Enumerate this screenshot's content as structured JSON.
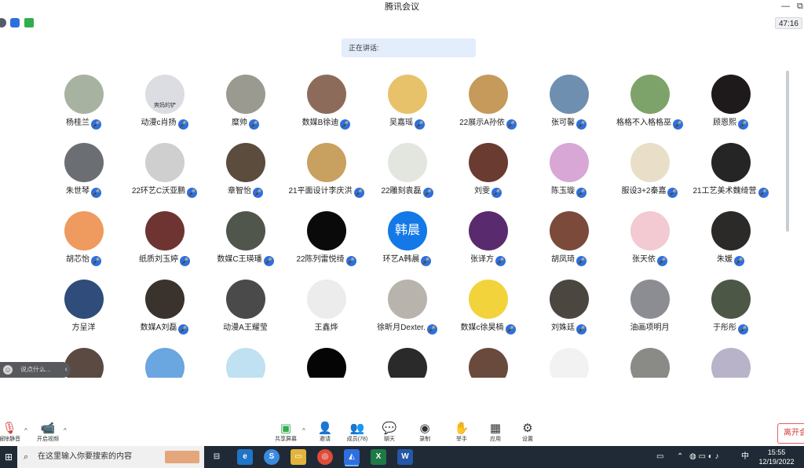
{
  "window": {
    "title": "腾讯会议",
    "minimize": "—",
    "restore": "⧉"
  },
  "topbar": {
    "timer": "47:16",
    "icons": [
      {
        "name": "network-status-icon",
        "color": "#555b66"
      },
      {
        "name": "security-shield-icon",
        "color": "#2d6fe0"
      },
      {
        "name": "signal-bars-icon",
        "color": "#2fae4e"
      }
    ]
  },
  "speaking": {
    "label": "正在讲话:"
  },
  "participants": [
    {
      "name": "杨桂兰",
      "mic": true,
      "avatar": {
        "bg": "#a7b3a0",
        "text": ""
      }
    },
    {
      "name": "动漫c肖扬",
      "mic": true,
      "avatar": {
        "bg": "#dcdde3",
        "text": "爽妈的铲"
      }
    },
    {
      "name": "糜帅",
      "mic": true,
      "avatar": {
        "bg": "#9a9a90",
        "text": ""
      }
    },
    {
      "name": "数媒B徐迪",
      "mic": true,
      "avatar": {
        "bg": "#8d6b5a",
        "text": ""
      }
    },
    {
      "name": "吴嘉瑶",
      "mic": true,
      "avatar": {
        "bg": "#e7c26a",
        "text": ""
      }
    },
    {
      "name": "22展示A孙依",
      "mic": true,
      "avatar": {
        "bg": "#c59a5a",
        "text": ""
      }
    },
    {
      "name": "张可馨",
      "mic": true,
      "avatar": {
        "bg": "#6f8fb0",
        "text": ""
      }
    },
    {
      "name": "格格不入格格巫",
      "mic": true,
      "avatar": {
        "bg": "#7ea36a",
        "text": ""
      }
    },
    {
      "name": "顾恩熙",
      "mic": true,
      "avatar": {
        "bg": "#1e1a1c",
        "text": ""
      }
    },
    {
      "name": "朱世琴",
      "mic": true,
      "avatar": {
        "bg": "#6b6f74",
        "text": ""
      }
    },
    {
      "name": "22环艺C沃亚鹏",
      "mic": true,
      "avatar": {
        "bg": "#cfcfcf",
        "text": ""
      }
    },
    {
      "name": "章智怡",
      "mic": true,
      "avatar": {
        "bg": "#5b4c3e",
        "text": ""
      }
    },
    {
      "name": "21平面设计李庆洪",
      "mic": true,
      "avatar": {
        "bg": "#c8a060",
        "text": ""
      }
    },
    {
      "name": "22雕刻袁磊",
      "mic": true,
      "avatar": {
        "bg": "#e3e6df",
        "text": ""
      }
    },
    {
      "name": "刘雯",
      "mic": true,
      "avatar": {
        "bg": "#6a3b30",
        "text": ""
      }
    },
    {
      "name": "陈玉璇",
      "mic": true,
      "avatar": {
        "bg": "#d8a7d6",
        "text": ""
      }
    },
    {
      "name": "服设3+2秦嘉",
      "mic": true,
      "avatar": {
        "bg": "#e9dfc9",
        "text": ""
      }
    },
    {
      "name": "21工艺美术魏绮营",
      "mic": true,
      "avatar": {
        "bg": "#252525",
        "text": ""
      }
    },
    {
      "name": "胡芯怡",
      "mic": true,
      "avatar": {
        "bg": "#ef9a5e",
        "text": ""
      }
    },
    {
      "name": "纸质刘玉婷",
      "mic": true,
      "avatar": {
        "bg": "#6e3432",
        "text": ""
      }
    },
    {
      "name": "数媒C王瑛璠",
      "mic": true,
      "avatar": {
        "bg": "#50564b",
        "text": ""
      }
    },
    {
      "name": "22陈列雷悦绮",
      "mic": true,
      "avatar": {
        "bg": "#0a0a0a",
        "text": ""
      }
    },
    {
      "name": "环艺A韩晨",
      "mic": true,
      "avatar": {
        "bg": "#1479e6",
        "text": "韩晨"
      }
    },
    {
      "name": "张译方",
      "mic": true,
      "avatar": {
        "bg": "#5a2a6e",
        "text": ""
      }
    },
    {
      "name": "胡凤琦",
      "mic": true,
      "avatar": {
        "bg": "#7b4a3a",
        "text": ""
      }
    },
    {
      "name": "张天依",
      "mic": true,
      "avatar": {
        "bg": "#f3c9d2",
        "text": ""
      }
    },
    {
      "name": "朱媛",
      "mic": true,
      "avatar": {
        "bg": "#2c2a28",
        "text": ""
      }
    },
    {
      "name": "方呈洋",
      "mic": false,
      "avatar": {
        "bg": "#2f4c7a",
        "text": ""
      }
    },
    {
      "name": "数媒A刘磊",
      "mic": true,
      "avatar": {
        "bg": "#3a322c",
        "text": ""
      }
    },
    {
      "name": "动漫A王耀莹",
      "mic": false,
      "avatar": {
        "bg": "#4a4a4a",
        "text": ""
      }
    },
    {
      "name": "王鑫烨",
      "mic": false,
      "avatar": {
        "bg": "#ececec",
        "text": ""
      }
    },
    {
      "name": "徐昕月Dexter.",
      "mic": true,
      "avatar": {
        "bg": "#b9b3ae",
        "text": ""
      }
    },
    {
      "name": "数媒c徐昊楠",
      "mic": true,
      "avatar": {
        "bg": "#f2d33c",
        "text": ""
      }
    },
    {
      "name": "刘姝廷",
      "mic": true,
      "avatar": {
        "bg": "#4b4640",
        "text": ""
      }
    },
    {
      "name": "油画项明月",
      "mic": false,
      "avatar": {
        "bg": "#8c8d93",
        "text": ""
      }
    },
    {
      "name": "于彤彤",
      "mic": true,
      "avatar": {
        "bg": "#4d5746",
        "text": ""
      }
    },
    {
      "name": "",
      "mic": false,
      "avatar": {
        "bg": "#5a4a42",
        "text": ""
      }
    },
    {
      "name": "",
      "mic": false,
      "avatar": {
        "bg": "#6aa6e0",
        "text": ""
      }
    },
    {
      "name": "",
      "mic": false,
      "avatar": {
        "bg": "#bfe1f1",
        "text": ""
      }
    },
    {
      "name": "",
      "mic": false,
      "avatar": {
        "bg": "#050505",
        "text": ""
      }
    },
    {
      "name": "",
      "mic": false,
      "avatar": {
        "bg": "#2a2a2a",
        "text": ""
      }
    },
    {
      "name": "",
      "mic": false,
      "avatar": {
        "bg": "#6a4a3c",
        "text": ""
      }
    },
    {
      "name": "",
      "mic": false,
      "avatar": {
        "bg": "#f2f2f2",
        "text": ""
      }
    },
    {
      "name": "",
      "mic": false,
      "avatar": {
        "bg": "#8a8a86",
        "text": ""
      }
    },
    {
      "name": "",
      "mic": false,
      "avatar": {
        "bg": "#b8b3c8",
        "text": ""
      }
    }
  ],
  "chat": {
    "placeholder": "说点什么..."
  },
  "toolbar": {
    "mute": "解除静音",
    "video": "开启视频",
    "share": "共享屏幕",
    "invite": "邀请",
    "members": "成员(78)",
    "chat": "聊天",
    "record": "录制",
    "raise_hand": "举手",
    "apps": "应用",
    "settings": "设置",
    "leave": "离开会"
  },
  "taskbar": {
    "search_placeholder": "在这里输入你要搜索的内容",
    "time": "15:55",
    "date": "12/19/2022",
    "ime": "中"
  }
}
